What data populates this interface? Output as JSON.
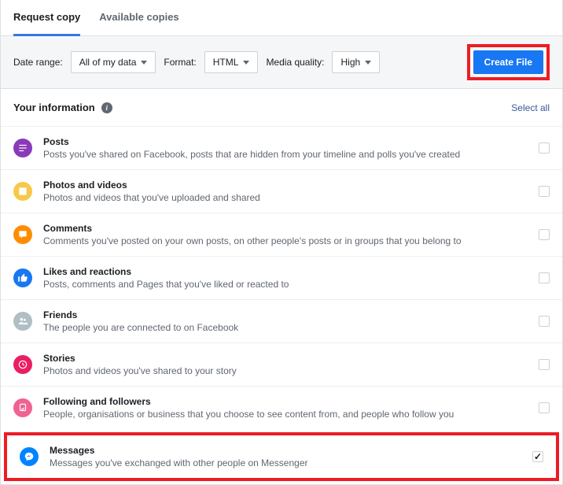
{
  "tabs": {
    "request": "Request copy",
    "available": "Available copies"
  },
  "filters": {
    "date_label": "Date range:",
    "date_value": "All of my data",
    "format_label": "Format:",
    "format_value": "HTML",
    "quality_label": "Media quality:",
    "quality_value": "High"
  },
  "create_button": "Create File",
  "section": {
    "title": "Your information",
    "select_all": "Select all"
  },
  "items": [
    {
      "title": "Posts",
      "desc": "Posts you've shared on Facebook, posts that are hidden from your timeline and polls you've created",
      "color": "#8a3ab9",
      "checked": false
    },
    {
      "title": "Photos and videos",
      "desc": "Photos and videos that you've uploaded and shared",
      "color": "#f7c948",
      "checked": false
    },
    {
      "title": "Comments",
      "desc": "Comments you've posted on your own posts, on other people's posts or in groups that you belong to",
      "color": "#ff8c00",
      "checked": false
    },
    {
      "title": "Likes and reactions",
      "desc": "Posts, comments and Pages that you've liked or reacted to",
      "color": "#1877f2",
      "checked": false
    },
    {
      "title": "Friends",
      "desc": "The people you are connected to on Facebook",
      "color": "#b0bec5",
      "checked": false
    },
    {
      "title": "Stories",
      "desc": "Photos and videos you've shared to your story",
      "color": "#e91e63",
      "checked": false
    },
    {
      "title": "Following and followers",
      "desc": "People, organisations or business that you choose to see content from, and people who follow you",
      "color": "#f06292",
      "checked": false
    },
    {
      "title": "Messages",
      "desc": "Messages you've exchanged with other people on Messenger",
      "color": "#0084ff",
      "checked": true
    }
  ]
}
